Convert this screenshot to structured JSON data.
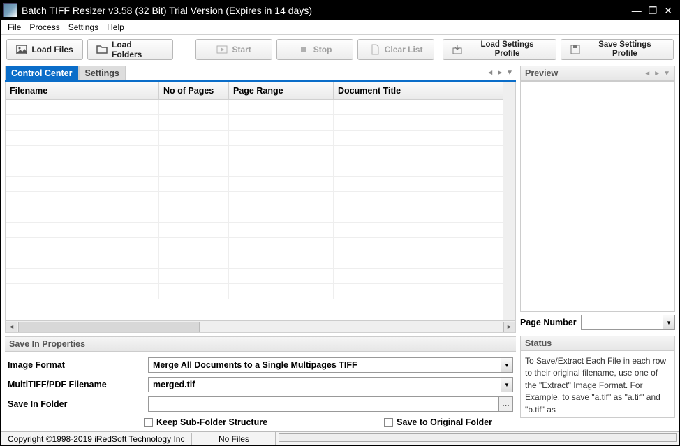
{
  "window": {
    "title": "Batch TIFF Resizer v3.58 (32 Bit)  Trial Version (Expires in 14 days)"
  },
  "menu": {
    "file": "File",
    "process": "Process",
    "settings": "Settings",
    "help": "Help"
  },
  "toolbar": {
    "load_files": "Load Files",
    "load_folders": "Load Folders",
    "start": "Start",
    "stop": "Stop",
    "clear_list": "Clear List",
    "load_profile": "Load Settings Profile",
    "save_profile": "Save Settings Profile"
  },
  "tabs": {
    "control_center": "Control Center",
    "settings": "Settings"
  },
  "table": {
    "col_filename": "Filename",
    "col_pages": "No of Pages",
    "col_range": "Page Range",
    "col_title": "Document Title"
  },
  "preview": {
    "label": "Preview",
    "page_number_label": "Page Number",
    "page_number_value": ""
  },
  "save_props": {
    "heading": "Save In Properties",
    "image_format_label": "Image Format",
    "image_format_value": "Merge All Documents to a Single Multipages TIFF",
    "multitiff_label": "MultiTIFF/PDF Filename",
    "multitiff_value": "merged.tif",
    "save_folder_label": "Save In Folder",
    "save_folder_value": "",
    "keep_subfolder": "Keep Sub-Folder Structure",
    "save_original": "Save to Original Folder"
  },
  "status": {
    "heading": "Status",
    "text": "To Save/Extract Each File in each row to their original filename, use one of the \"Extract\" Image Format. For Example, to save \"a.tif\" as \"a.tif\" and \"b.tif\" as"
  },
  "statusbar": {
    "copyright": "Copyright ©1998-2019 iRedSoft Technology Inc",
    "files": "No Files"
  }
}
